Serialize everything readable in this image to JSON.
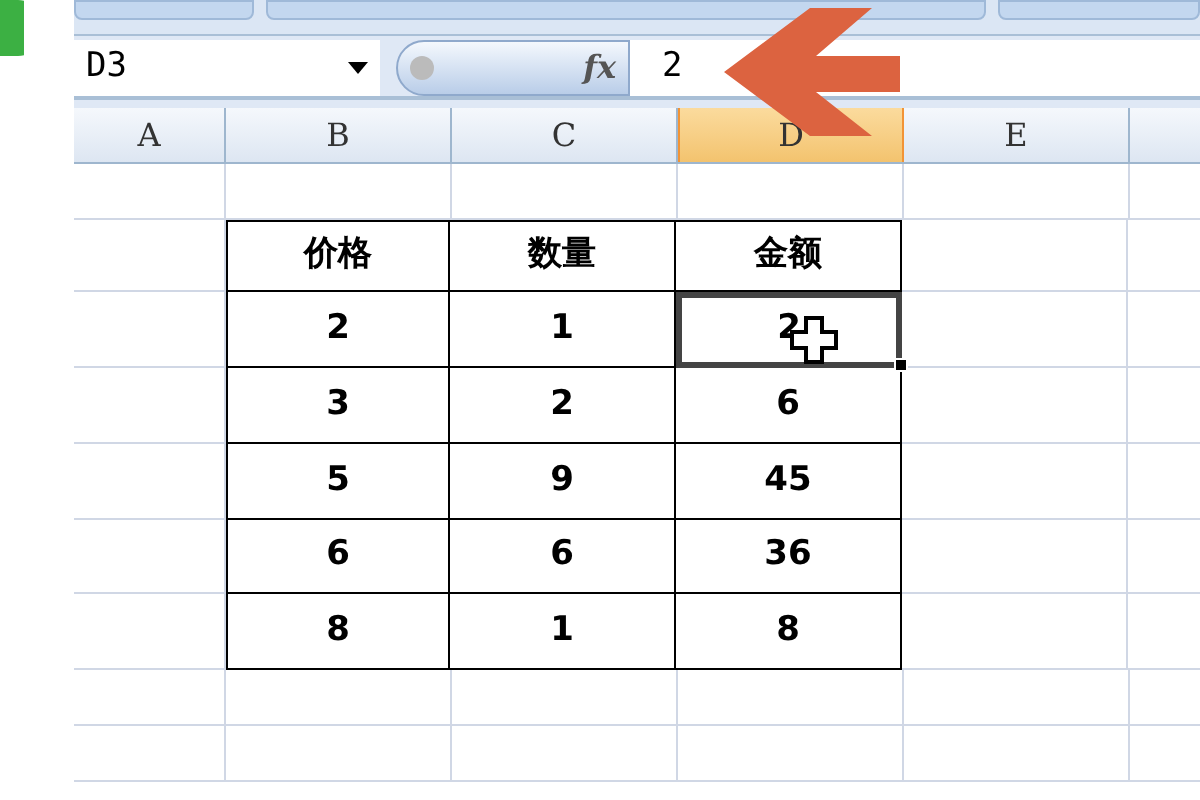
{
  "formula_bar": {
    "name_box": "D3",
    "formula": "2",
    "function_label": "fx"
  },
  "columns": [
    {
      "label": "A",
      "selected": false
    },
    {
      "label": "B",
      "selected": false
    },
    {
      "label": "C",
      "selected": false
    },
    {
      "label": "D",
      "selected": true
    },
    {
      "label": "E",
      "selected": false
    }
  ],
  "table": {
    "header": [
      "价格",
      "数量",
      "金额"
    ],
    "rows": [
      [
        {
          "text": "2",
          "selected": false
        },
        {
          "text": "1",
          "selected": false
        },
        {
          "text": "2",
          "selected": true
        }
      ],
      [
        {
          "text": "3",
          "selected": false
        },
        {
          "text": "2",
          "selected": false
        },
        {
          "text": "6",
          "selected": false
        }
      ],
      [
        {
          "text": "5",
          "selected": false
        },
        {
          "text": "9",
          "selected": false
        },
        {
          "text": "45",
          "selected": false
        }
      ],
      [
        {
          "text": "6",
          "selected": false
        },
        {
          "text": "6",
          "selected": false
        },
        {
          "text": "36",
          "selected": false
        }
      ],
      [
        {
          "text": "8",
          "selected": false
        },
        {
          "text": "1",
          "selected": false
        },
        {
          "text": "8",
          "selected": false
        }
      ]
    ]
  }
}
